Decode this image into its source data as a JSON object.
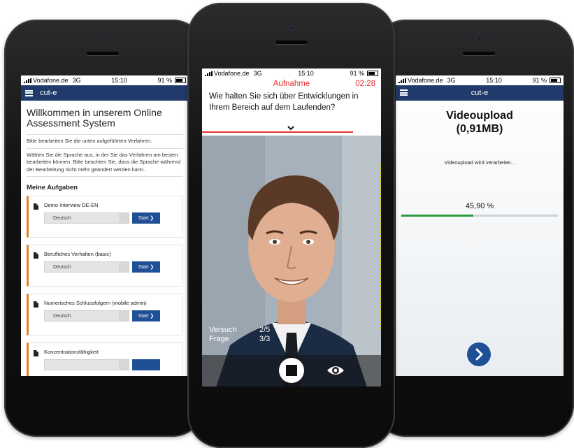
{
  "left_phone": {
    "status_bar": {
      "carrier": "Vodafone.de",
      "network": "3G",
      "time": "15:10",
      "battery": "91 %"
    },
    "navbar": {
      "title": "cut-e"
    },
    "welcome_title": "Willkommen in unserem Online Assessment System",
    "intro_text": "Bitte bearbeiten Sie die unten aufgeführten Verfahren.",
    "language_text": "Wählen Sie die Sprache aus, in der Sie das Verfahren am besten bearbeiten können. Bitte beachten Sie, dass die Sprache während der Bearbeitung nicht mehr geändert werden kann.",
    "tasks_heading": "Meine Aufgaben",
    "tasks": [
      {
        "name": "Demo Interview DE-EN",
        "language": "Deutsch",
        "button": "Start ❯"
      },
      {
        "name": "Berufliches Verhalten (basic)",
        "language": "Deutsch",
        "button": "Start ❯"
      },
      {
        "name": "Numerisches Schlussfolgern (mobile admin)",
        "language": "Deutsch",
        "button": "Start ❯"
      },
      {
        "name": "Konzentrationsfähigkeit",
        "language": "",
        "button": ""
      }
    ]
  },
  "center_phone": {
    "status_bar": {
      "carrier": "Vodafone.de",
      "network": "3G",
      "time": "15:10",
      "battery": "91 %"
    },
    "mode_label": "Aufnahme",
    "timer": "02:28",
    "question": "Wie halten Sie sich über Entwicklungen in Ihrem Bereich auf dem Laufenden?",
    "attempt_label": "Versuch",
    "attempt_value": "2/5",
    "question_label": "Frage",
    "question_value": "3/3"
  },
  "right_phone": {
    "status_bar": {
      "carrier": "Vodafone.de",
      "network": "3G",
      "time": "15:10",
      "battery": "91 %"
    },
    "navbar": {
      "title": "cut-e"
    },
    "upload_title_line1": "Videoupload",
    "upload_title_line2": "(0,91MB)",
    "upload_status": "Videoupload wird verarbeitet...",
    "progress_label": "45,90 %",
    "progress_fraction": 0.459
  },
  "colors": {
    "navy": "#1f3a6b",
    "button_blue": "#1f4f95",
    "accent_orange": "#e0822c",
    "record_red": "#e8332e",
    "progress_green": "#2b9b42"
  },
  "icons": [
    "hamburger-icon",
    "document-icon",
    "chevron-right-icon",
    "chevron-down-icon",
    "stop-icon",
    "eye-icon",
    "signal-icon",
    "battery-icon"
  ]
}
